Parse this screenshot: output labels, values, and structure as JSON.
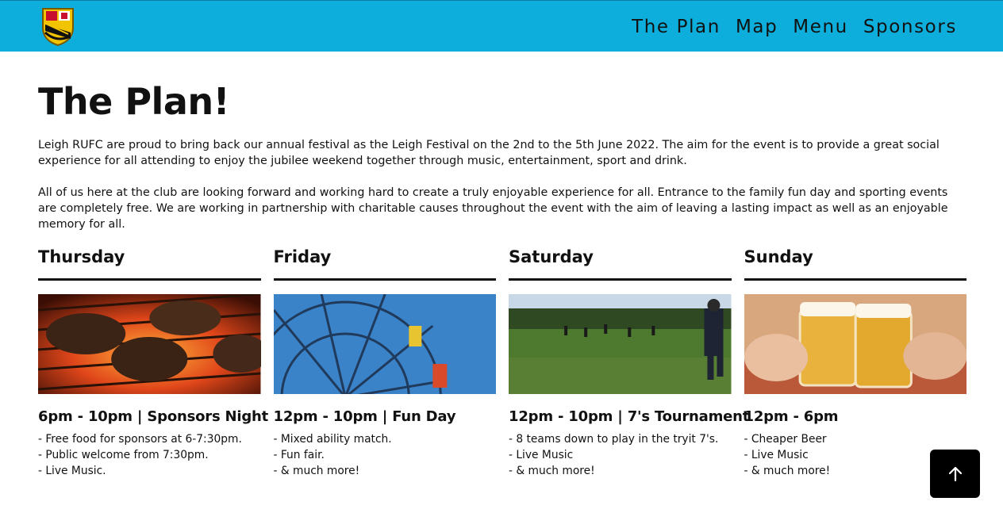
{
  "nav": {
    "links": [
      "The Plan",
      "Map",
      "Menu",
      "Sponsors"
    ]
  },
  "main": {
    "title": "The Plan!",
    "intro": [
      "Leigh RUFC are proud to bring back our annual festival as the Leigh Festival on the 2nd to the 5th June 2022. The aim for the event is to provide a great social experience for all attending to enjoy the jubilee weekend together through music, entertainment, sport and drink.",
      "All of us here at the club are looking forward and working hard to create a truly enjoyable experience for all. Entrance to the family fun day and sporting events are completely free. We are working in partnership with charitable causes throughout the event with the aim of leaving a lasting impact as well as an enjoyable memory for all."
    ],
    "days": [
      {
        "name": "Thursday",
        "time": "6pm - 10pm | Sponsors Night",
        "points": [
          "- Free food for sponsors at 6-7:30pm.",
          "- Public welcome from 7:30pm.",
          "- Live Music."
        ]
      },
      {
        "name": "Friday",
        "time": "12pm - 10pm | Fun Day",
        "points": [
          "- Mixed ability match.",
          "- Fun fair.",
          "- & much more!"
        ]
      },
      {
        "name": "Saturday",
        "time": "12pm - 10pm | 7's Tournament",
        "points": [
          "- 8 teams down to play in the tryit 7's.",
          "- Live Music",
          "- & much more!"
        ]
      },
      {
        "name": "Sunday",
        "time": "12pm - 6pm",
        "points": [
          "- Cheaper Beer",
          "- Live Music",
          "- & much more!"
        ]
      }
    ]
  },
  "colors": {
    "nav_bg": "#0eaedc",
    "text": "#111111",
    "button_bg": "#000000"
  },
  "icons": {
    "logo": "club-crest-icon",
    "back_to_top": "arrow-up-icon"
  }
}
